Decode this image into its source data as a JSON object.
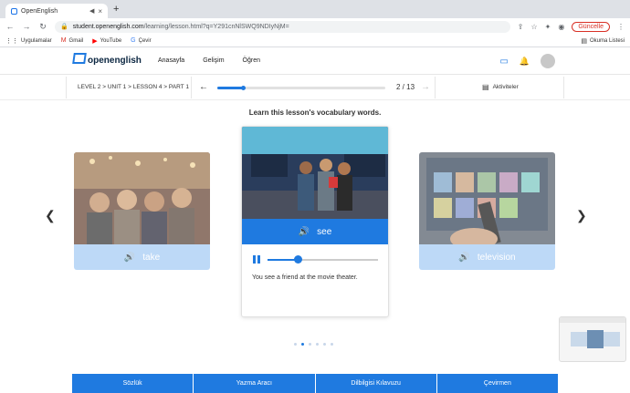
{
  "browser": {
    "tab_title": "OpenEnglish",
    "tab_audio_icon": "◀",
    "tab_close": "×",
    "new_tab": "+",
    "url_host": "student.openenglish.com",
    "url_path": "/learning/lesson.html?q=Y291cnNlSWQ9NDIyNjM=",
    "update_label": "Güncelle",
    "bookmarks": [
      {
        "label": "Uygulamalar",
        "icon": "apps-grid-icon"
      },
      {
        "label": "Gmail",
        "icon": "gmail-icon"
      },
      {
        "label": "YouTube",
        "icon": "youtube-icon"
      },
      {
        "label": "Çevir",
        "icon": "translate-icon"
      }
    ],
    "reading_list": "Okuma Listesi"
  },
  "site": {
    "logo_open": "open",
    "logo_english": "english",
    "nav": [
      "Anasayfa",
      "Gelişim",
      "Öğren"
    ]
  },
  "lesson": {
    "breadcrumb": "LEVEL 2 > UNIT 1 > LESSON 4 > PART 1",
    "progress_current": 2,
    "progress_total": 13,
    "progress_text": "2 / 13",
    "activities": "Aktiviteler"
  },
  "content": {
    "instruction": "Learn this lesson's vocabulary words.",
    "cards": [
      {
        "word": "take",
        "state": "previous"
      },
      {
        "word": "see",
        "state": "current",
        "sentence": "You see a friend at the movie theater.",
        "audio_progress": 0.28
      },
      {
        "word": "television",
        "state": "next"
      }
    ],
    "carousel_dots": 6,
    "carousel_active": 1
  },
  "bottom_tools": [
    "Sözlük",
    "Yazma Aracı",
    "Dilbilgisi Kılavuzu",
    "Çevirmen"
  ],
  "colors": {
    "primary": "#1f7ae0",
    "primary_light": "#a8cdf5",
    "alert": "#d93025"
  }
}
